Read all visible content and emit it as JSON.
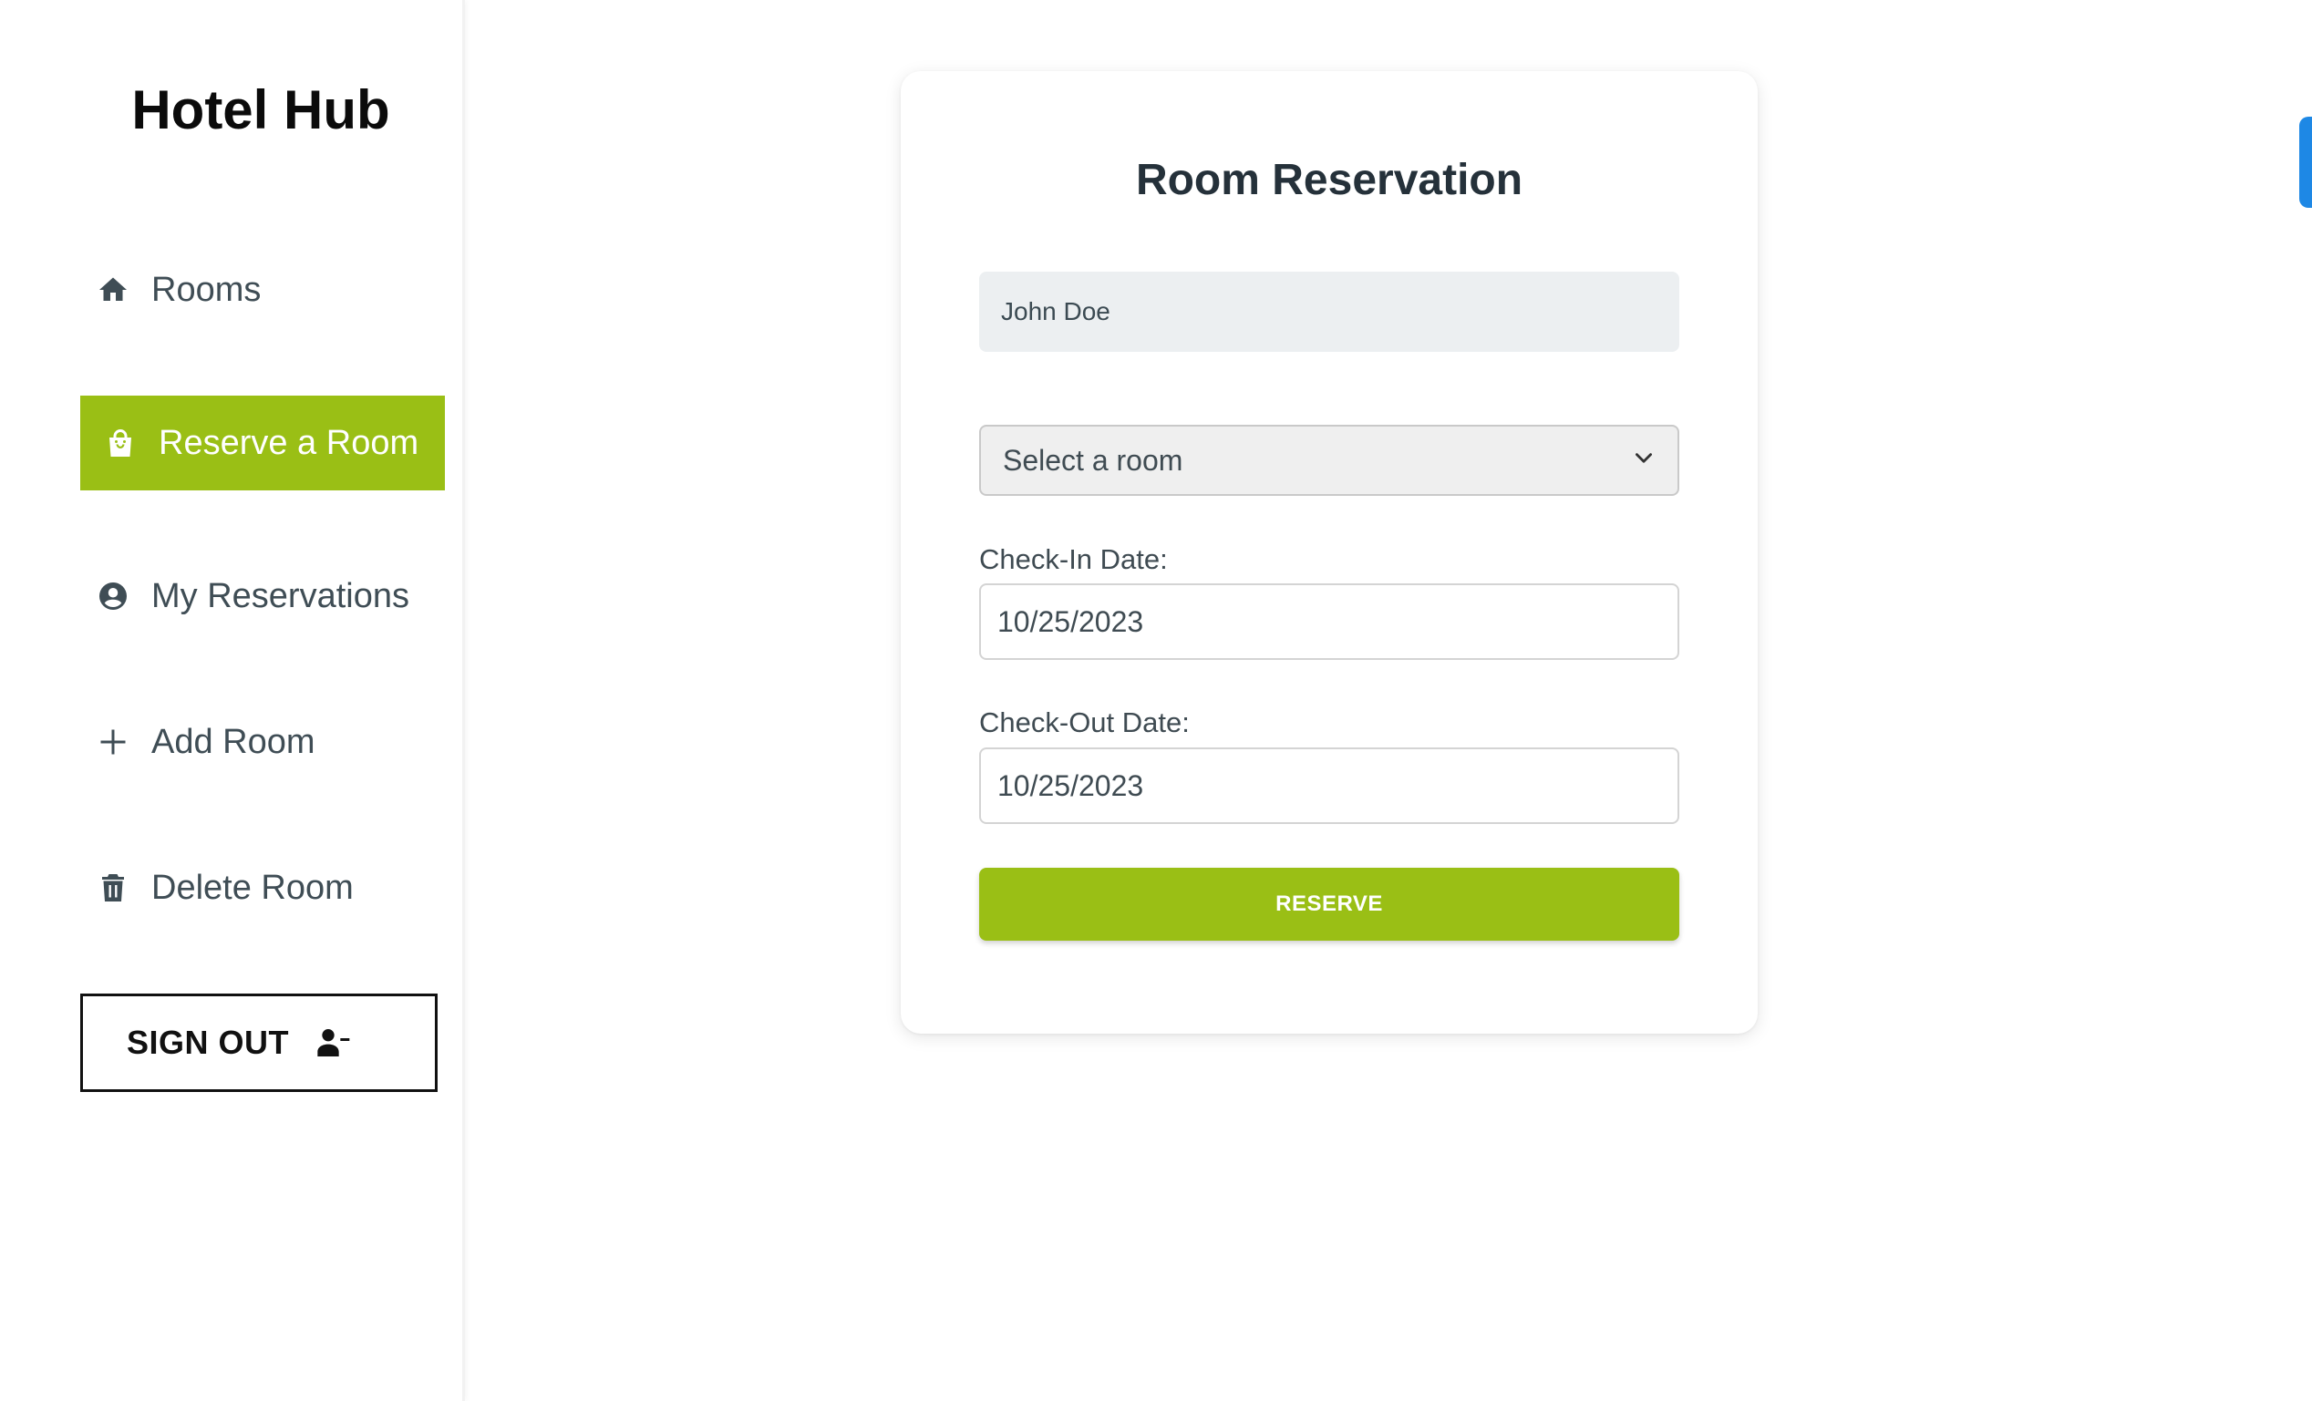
{
  "app": {
    "brand": "Hotel Hub"
  },
  "sidebar": {
    "items": [
      {
        "label": "Rooms",
        "icon": "home-icon",
        "active": false
      },
      {
        "label": "Reserve a Room",
        "icon": "shopping-bag-icon",
        "active": true
      },
      {
        "label": "My Reservations",
        "icon": "user-circle-icon",
        "active": false
      },
      {
        "label": "Add Room",
        "icon": "plus-icon",
        "active": false
      },
      {
        "label": "Delete Room",
        "icon": "trash-icon",
        "active": false
      }
    ],
    "signout": {
      "label": "SIGN OUT",
      "icon": "user-minus-icon"
    }
  },
  "form": {
    "title": "Room Reservation",
    "name_value": "John Doe",
    "room_select": {
      "selected": "Select a room"
    },
    "checkin": {
      "label": "Check-In Date:",
      "value": "10/25/2023"
    },
    "checkout": {
      "label": "Check-Out Date:",
      "value": "10/25/2023"
    },
    "submit_label": "RESERVE"
  },
  "colors": {
    "accent": "#9abf15",
    "text_dark": "#25313a",
    "nav_text": "#3f4d55",
    "edge_tab": "#1e88e5"
  }
}
